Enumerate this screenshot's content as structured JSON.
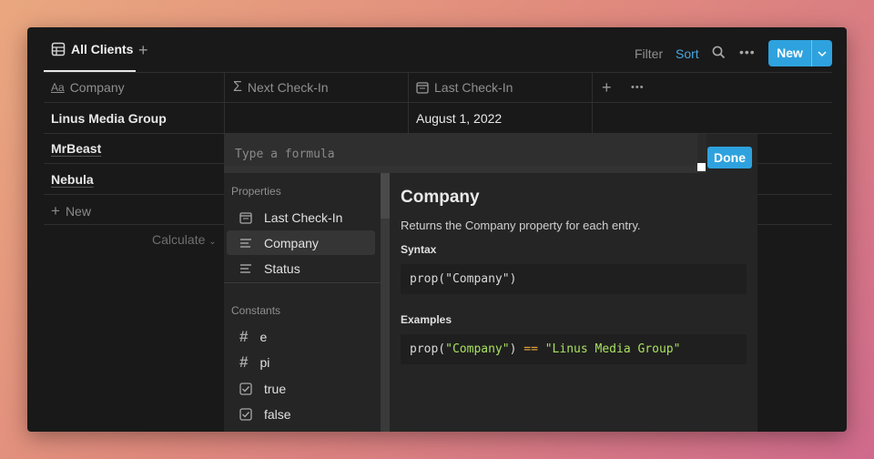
{
  "toolbar": {
    "view_tab_label": "All Clients",
    "filter_label": "Filter",
    "sort_label": "Sort",
    "new_label": "New",
    "accent_color": "#2ea2de"
  },
  "table": {
    "columns": [
      {
        "label": "Company",
        "icon": "text-property-icon"
      },
      {
        "label": "Next Check-In",
        "icon": "formula-sigma-icon"
      },
      {
        "label": "Last Check-In",
        "icon": "calendar-icon"
      }
    ],
    "rows": [
      {
        "company": "Linus Media Group",
        "next_check_in": "",
        "last_check_in": "August 1, 2022"
      },
      {
        "company": "MrBeast",
        "next_check_in": "",
        "last_check_in": ""
      },
      {
        "company": "Nebula",
        "next_check_in": "",
        "last_check_in": ""
      }
    ],
    "new_row_label": "New",
    "calculate_label": "Calculate"
  },
  "formula_editor": {
    "placeholder": "Type a formula",
    "done_label": "Done",
    "properties_title": "Properties",
    "properties": [
      {
        "label": "Last Check-In",
        "icon": "calendar-icon"
      },
      {
        "label": "Company",
        "icon": "text-lines-icon"
      },
      {
        "label": "Status",
        "icon": "text-lines-icon"
      }
    ],
    "constants_title": "Constants",
    "constants": [
      {
        "label": "e",
        "icon": "hash-icon"
      },
      {
        "label": "pi",
        "icon": "hash-icon"
      },
      {
        "label": "true",
        "icon": "checkbox-icon"
      },
      {
        "label": "false",
        "icon": "checkbox-icon"
      }
    ],
    "detail": {
      "title": "Company",
      "description": "Returns the Company property for each entry.",
      "syntax_title": "Syntax",
      "syntax_prefix": "prop(",
      "syntax_arg": "\"Company\"",
      "syntax_suffix": ")",
      "examples_title": "Examples",
      "example_prefix": "prop(",
      "example_arg": "\"Company\"",
      "example_mid": ")",
      "example_op": "==",
      "example_value": "\"Linus Media Group\""
    }
  }
}
